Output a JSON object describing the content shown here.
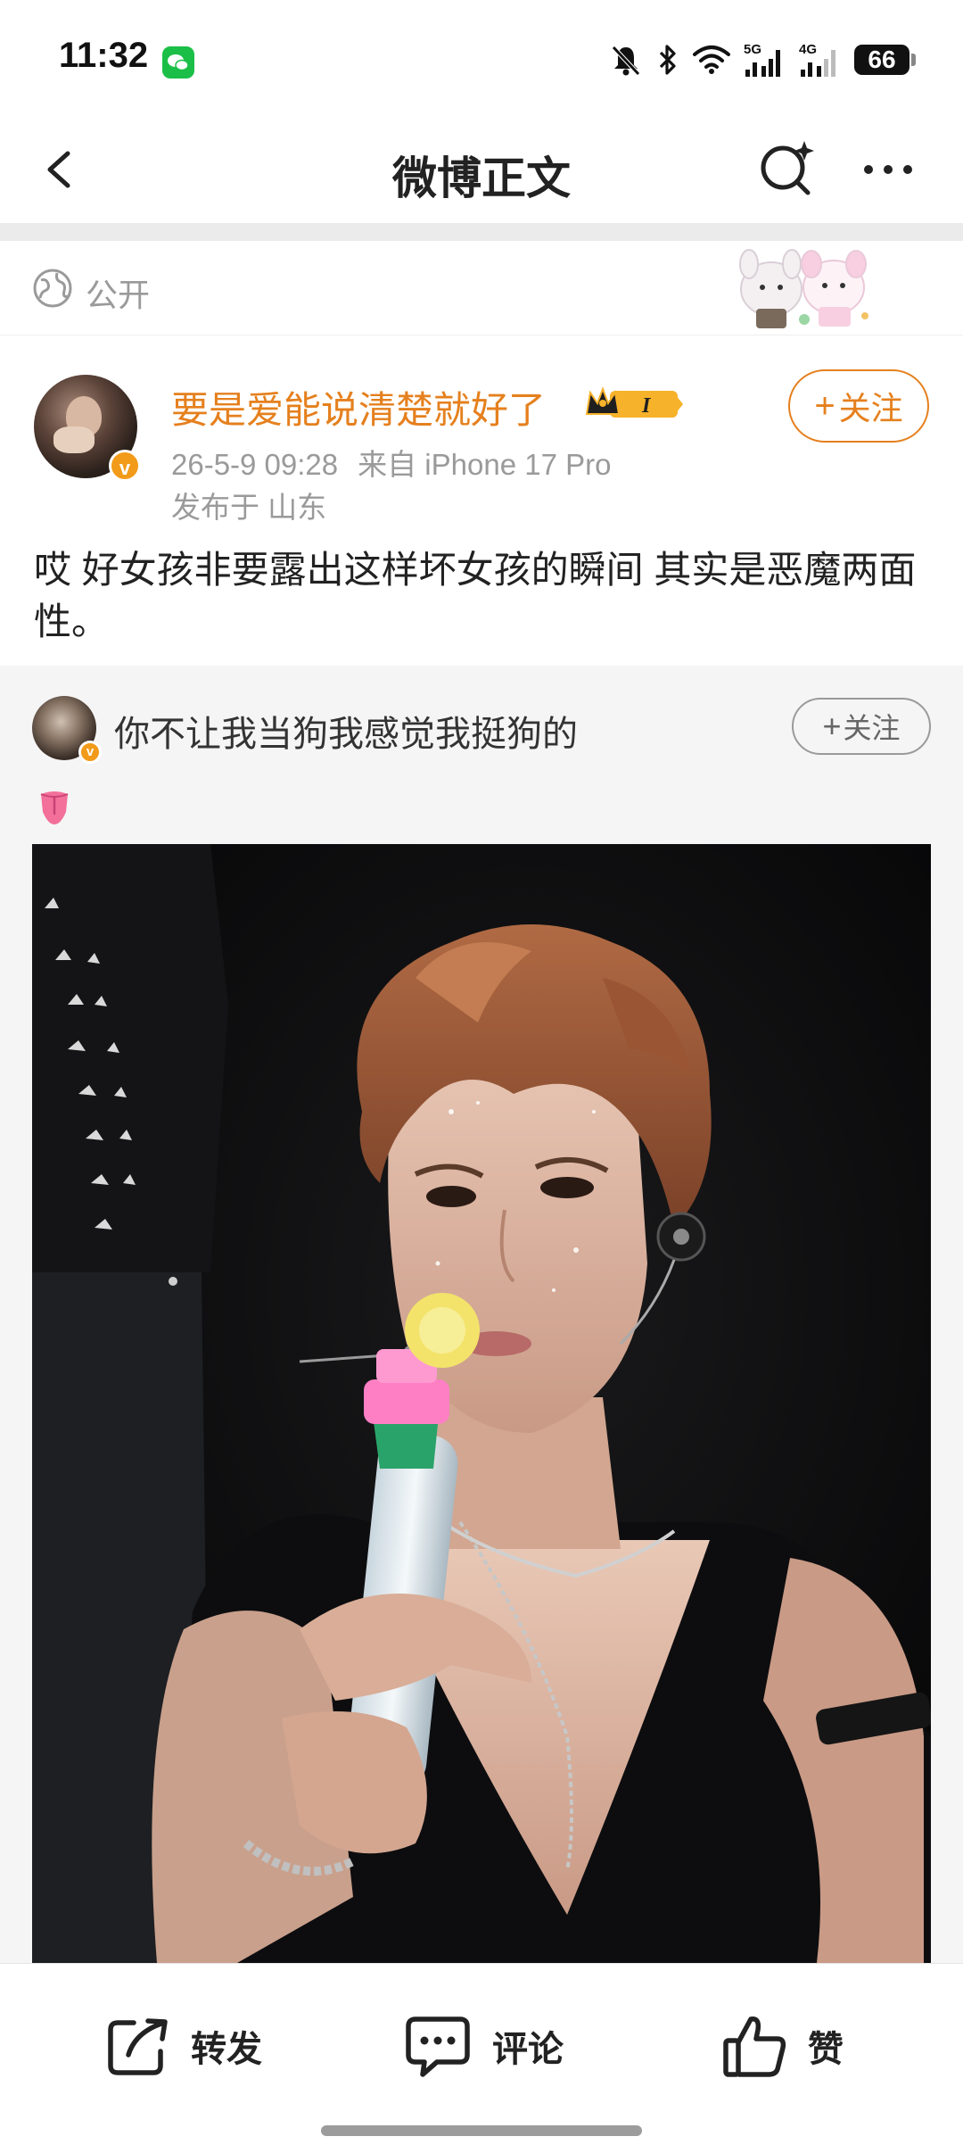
{
  "status_bar": {
    "time": "11:32",
    "signal_5g": "5G",
    "signal_4g": "4G",
    "battery": "66",
    "icons": [
      "wechat-icon",
      "mute-bell-icon",
      "bluetooth-icon",
      "wifi-icon",
      "signal-icon",
      "battery-icon"
    ]
  },
  "nav": {
    "title": "微博正文",
    "icons": [
      "back-chevron-icon",
      "search-sparkle-icon",
      "more-dots-icon"
    ]
  },
  "visibility": {
    "label": "公开",
    "icon": "globe-icon"
  },
  "post": {
    "username": "要是爱能说清楚就好了",
    "vip_level": "I",
    "verified_mark": "v",
    "date": "26-5-9 09:28",
    "source": "来自 iPhone 17 Pro",
    "location": "发布于 山东",
    "follow_label": "关注",
    "follow_plus": "+",
    "text": "哎 好女孩非要露出这样坏女孩的瞬间 其实是恶魔两面性。",
    "name_color": "#e5801e"
  },
  "repost": {
    "username": "你不让我当狗我感觉我挺狗的",
    "verified_mark": "v",
    "follow_label": "关注",
    "follow_plus": "+",
    "emoji": "tongue-emoji"
  },
  "actions": {
    "repost": "转发",
    "comment": "评论",
    "like": "赞"
  }
}
